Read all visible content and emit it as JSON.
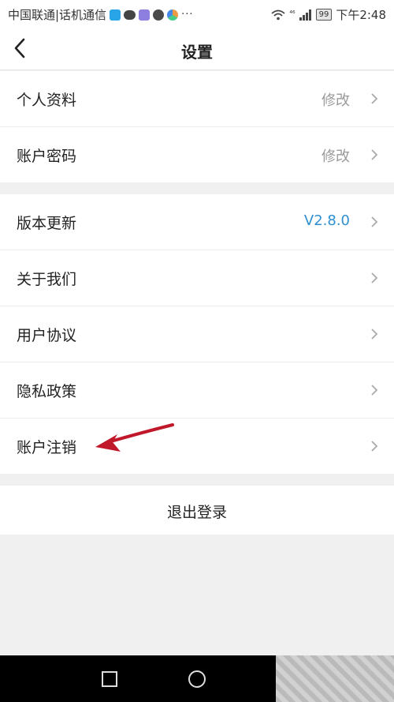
{
  "status_bar": {
    "carrier": "中国联通|话机通信",
    "time": "下午2:48",
    "battery": "99",
    "network": "⁴⁶",
    "icons": [
      "qq-icon",
      "message-icon",
      "app-icon",
      "wechat-icon",
      "browser-icon"
    ]
  },
  "header": {
    "title": "设置",
    "back_icon": "back-icon"
  },
  "group1": [
    {
      "label": "个人资料",
      "value": "修改"
    },
    {
      "label": "账户密码",
      "value": "修改"
    }
  ],
  "group2": [
    {
      "label": "版本更新",
      "value": "V2.8.0"
    },
    {
      "label": "关于我们",
      "value": ""
    },
    {
      "label": "用户协议",
      "value": ""
    },
    {
      "label": "隐私政策",
      "value": ""
    },
    {
      "label": "账户注销",
      "value": ""
    }
  ],
  "logout": {
    "label": "退出登录"
  },
  "colors": {
    "accent": "#2f8fd0",
    "arrow": "#c0182a",
    "background": "#f0f0f0"
  }
}
